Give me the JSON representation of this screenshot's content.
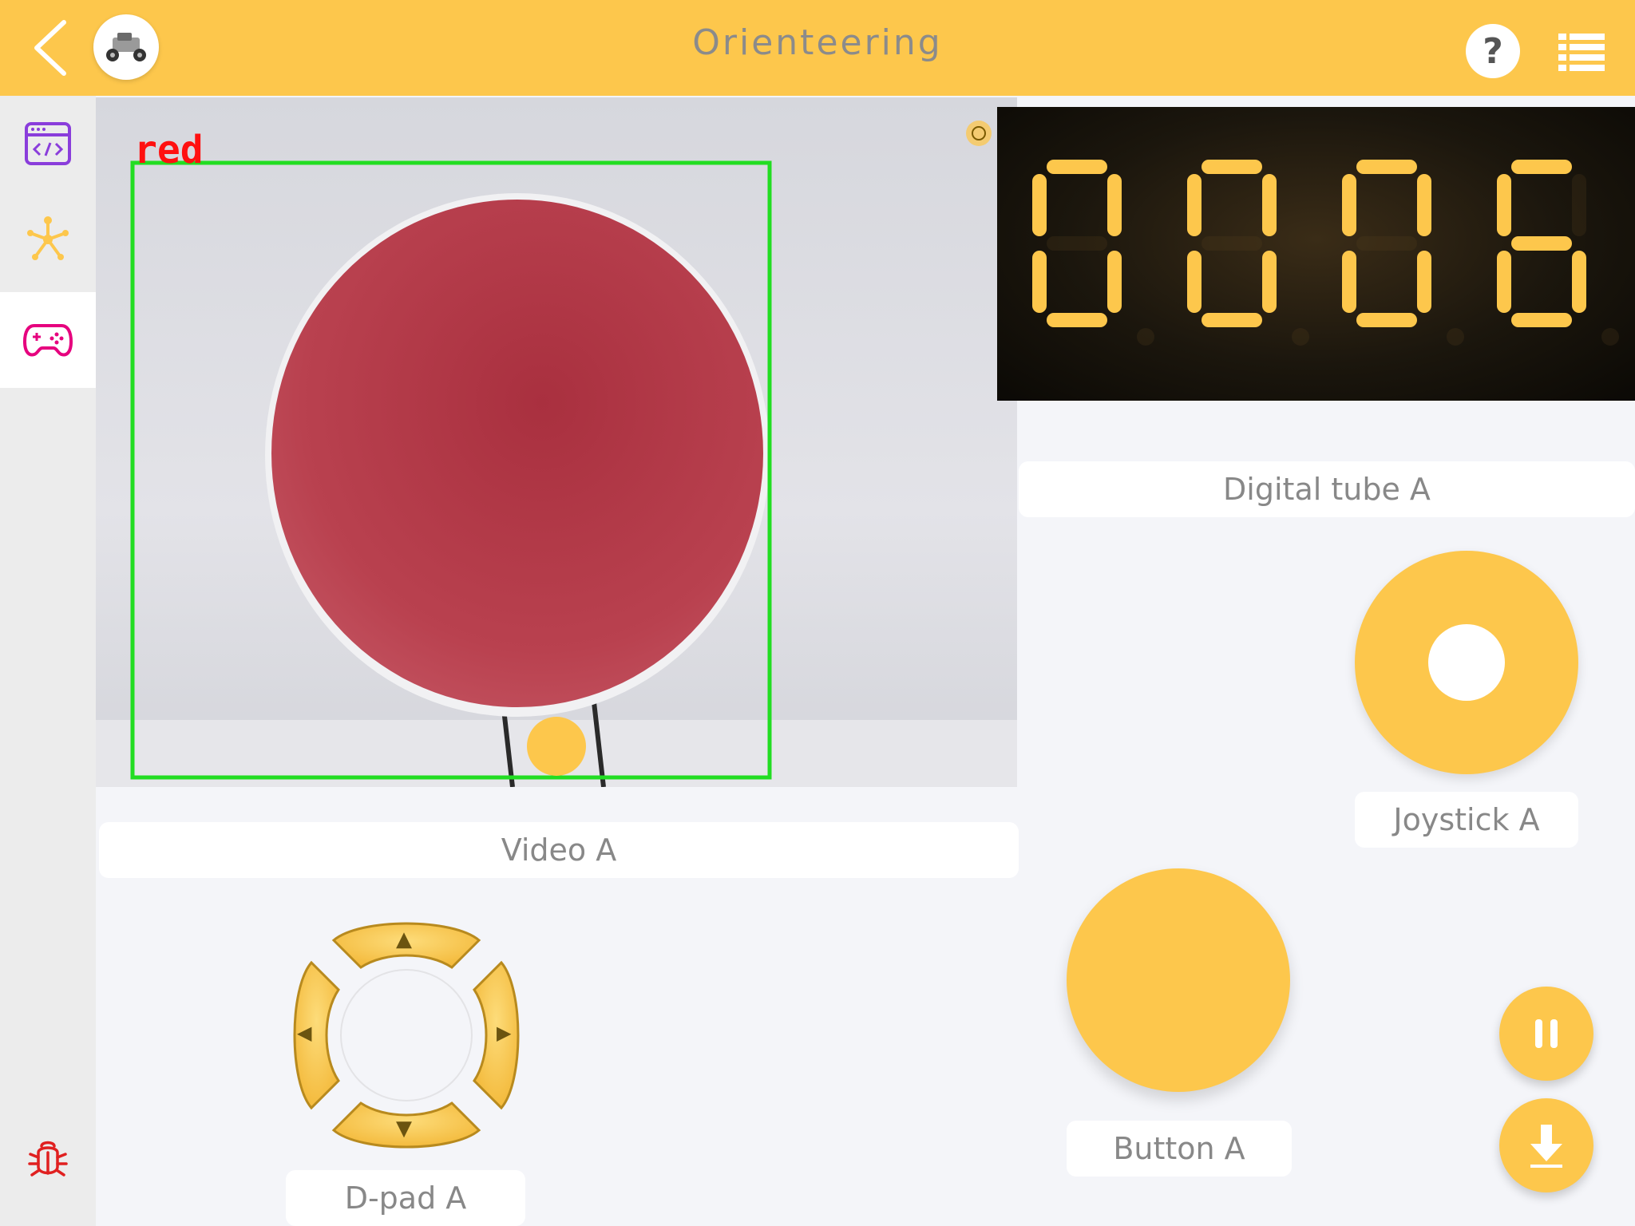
{
  "header": {
    "title": "Orienteering",
    "help_label": "?",
    "back_icon": "chevron-left-icon",
    "menu_icon": "list-menu-icon",
    "avatar_icon": "robot-car-icon"
  },
  "sidebar": {
    "items": [
      {
        "icon": "code-window-icon",
        "active": false
      },
      {
        "icon": "network-node-icon",
        "active": false
      },
      {
        "icon": "gamepad-icon",
        "active": true
      }
    ],
    "bottom_icon": "bug-icon"
  },
  "video": {
    "label": "Video A",
    "detection_label": "red",
    "detection_box_color": "#22dd22"
  },
  "digital_tube": {
    "label": "Digital tube A",
    "digits": "0006",
    "segment_color": "#fdc74c"
  },
  "joystick": {
    "label": "Joystick A"
  },
  "button": {
    "label": "Button A"
  },
  "dpad": {
    "label": "D-pad A",
    "up": "▲",
    "down": "▼",
    "left": "◀",
    "right": "▶"
  },
  "fabs": {
    "pause_icon": "pause-icon",
    "download_icon": "download-icon"
  },
  "colors": {
    "accent": "#fdc74c",
    "background": "#f4f5f9",
    "sidebar_active_icon": "#e6007e",
    "sidebar_code_icon": "#8a3ddb",
    "bug_icon": "#e02020"
  }
}
